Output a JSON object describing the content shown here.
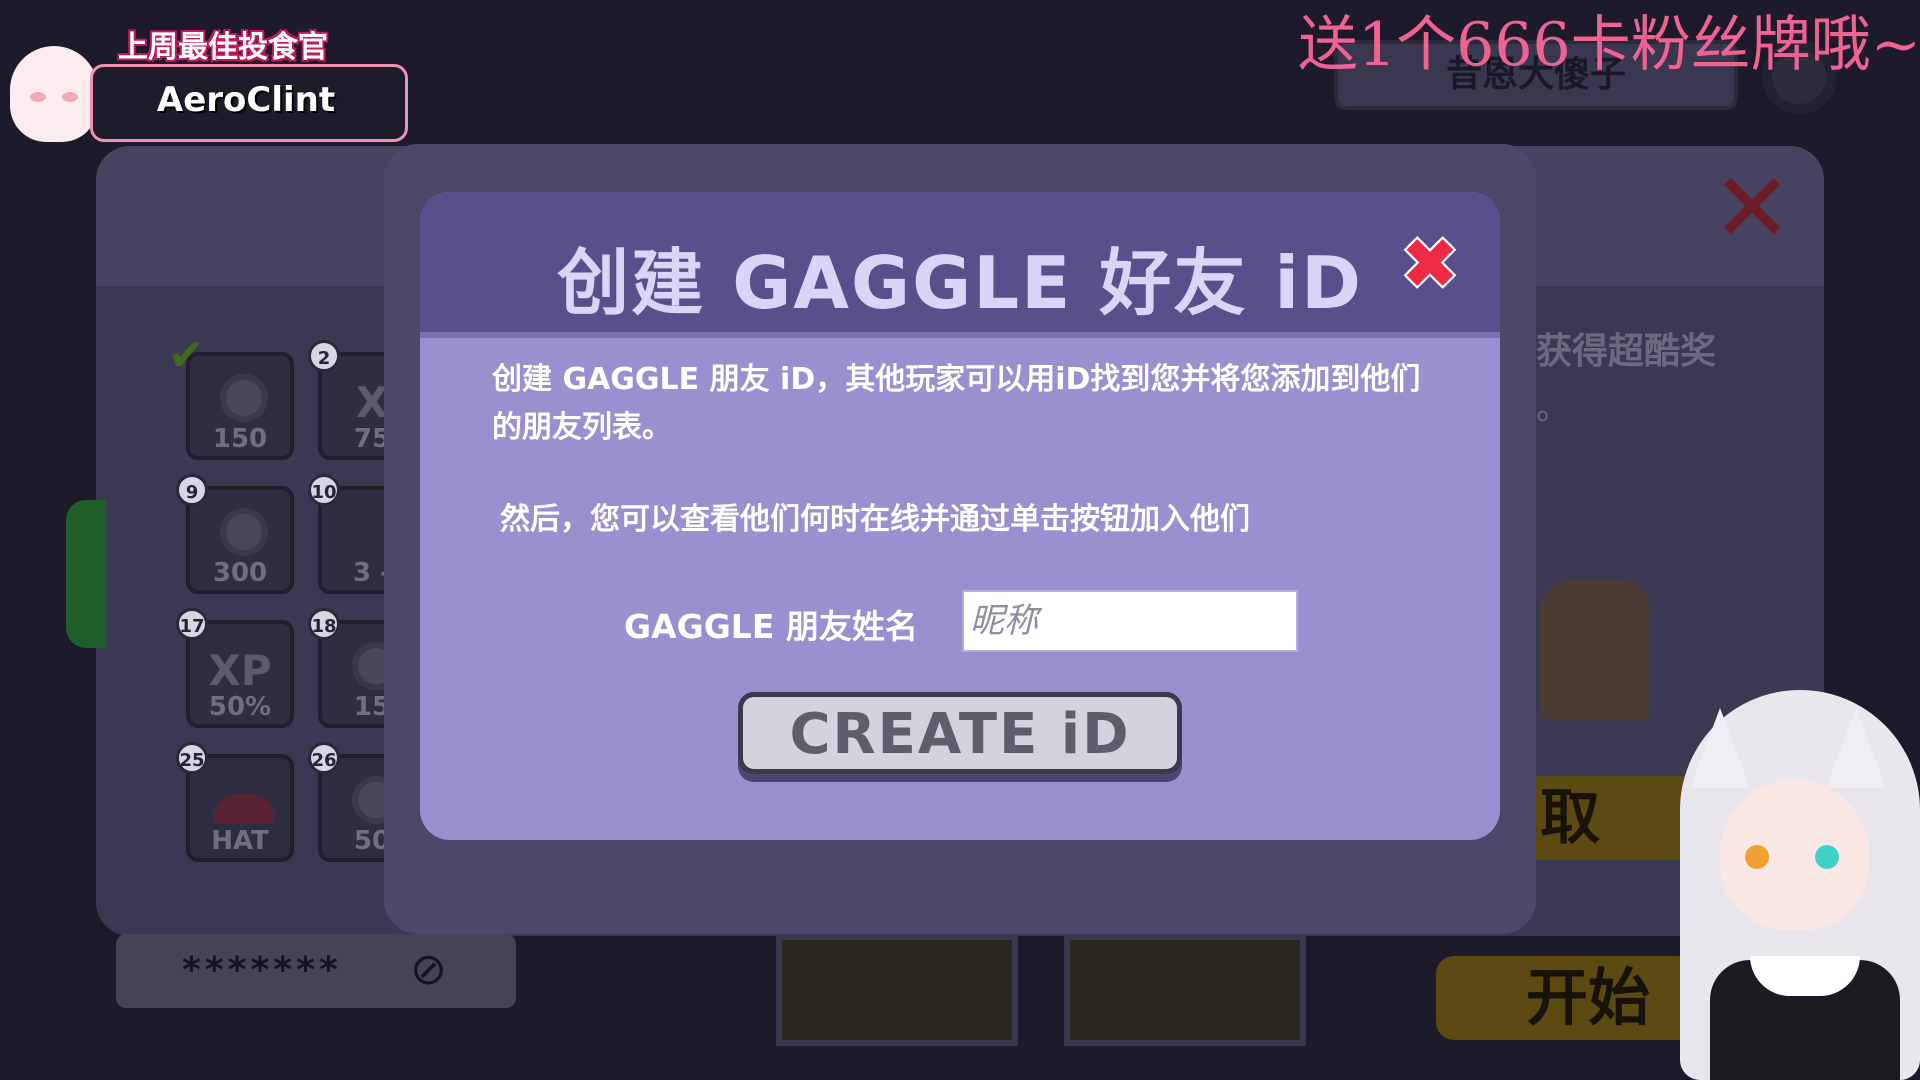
{
  "stream_overlay": {
    "caption": "送1个666卡粉丝牌哦~",
    "badge_title": "上周最佳投食官",
    "badge_name": "AeroClint"
  },
  "background": {
    "top_name": "昔恩大傻子",
    "reward_text": "获得超酷奖",
    "reward_dot": "。",
    "take_button": "取",
    "start_button": "开始",
    "password_mask": "*******",
    "rewards": [
      {
        "badge": "",
        "value": "150",
        "kind": "coin"
      },
      {
        "badge": "2",
        "value": "75",
        "kind": "xp"
      },
      {
        "badge": "9",
        "value": "300",
        "kind": "coin"
      },
      {
        "badge": "10",
        "value": "3 -",
        "kind": "bits"
      },
      {
        "badge": "17",
        "value": "50%",
        "kind": "xp"
      },
      {
        "badge": "18",
        "value": "15",
        "kind": "coin"
      },
      {
        "badge": "25",
        "value": "HAT",
        "kind": "hat"
      },
      {
        "badge": "26",
        "value": "50",
        "kind": "coin"
      }
    ],
    "reward_xp_label": "XP",
    "reward_xp_label_partial": "X"
  },
  "modal": {
    "title": "创建 GAGGLE 好友 iD",
    "description_1": "创建 GAGGLE 朋友 iD，其他玩家可以用iD找到您并将您添加到他们的朋友列表。",
    "description_2": "然后，您可以查看他们何时在线并通过单击按钮加入他们",
    "name_label": "GAGGLE 朋友姓名",
    "name_placeholder": "昵称",
    "name_value": "",
    "create_button": "CREATE iD"
  },
  "colors": {
    "modal_bg": "#9b8fcf",
    "modal_header": "#5a4f8a",
    "close_red": "#ee2a44",
    "caption_pink": "#f06292"
  }
}
